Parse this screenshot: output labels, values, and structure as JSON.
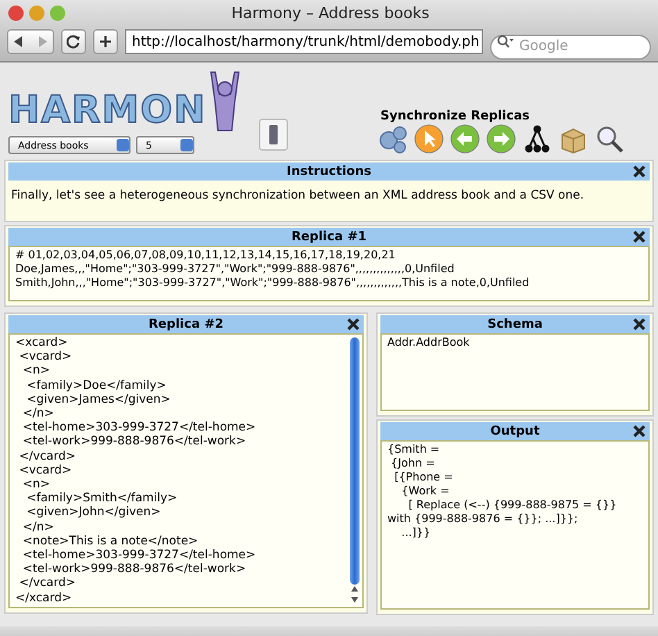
{
  "window": {
    "title": "Harmony – Address books"
  },
  "toolbar": {
    "url": "http://localhost/harmony/trunk/html/demobody.ph",
    "search_placeholder": "Google"
  },
  "header": {
    "logo": "HARMON",
    "selects": [
      {
        "value": "Address books"
      },
      {
        "value": "5"
      }
    ],
    "sync_title": "Synchronize Replicas"
  },
  "panels": [
    {
      "title": "Instructions",
      "kind": "note",
      "text": "Finally, let's see a heterogeneous synchronization between an XML address book and a CSV one."
    },
    {
      "title": "Replica #1",
      "kind": "editor",
      "text": "# 01,02,03,04,05,06,07,08,09,10,11,12,13,14,15,16,17,18,19,20,21\nDoe,James,,,\"Home\";\"303-999-3727\",\"Work\";\"999-888-9876\",,,,,,,,,,,,,,0,Unfiled\nSmith,John,,,\"Home\";\"303-999-3727\",\"Work\";\"999-888-9876\",,,,,,,,,,,,,This is a note,0,Unfiled"
    }
  ],
  "left_panels": [
    {
      "title": "Replica #2",
      "kind": "editor",
      "text": "<xcard>\n <vcard>\n  <n>\n   <family>Doe</family>\n   <given>James</given>\n  </n>\n  <tel-home>303-999-3727</tel-home>\n  <tel-work>999-888-9876</tel-work>\n </vcard>\n <vcard>\n  <n>\n   <family>Smith</family>\n   <given>John</given>\n  </n>\n  <note>This is a note</note>\n  <tel-home>303-999-3727</tel-home>\n  <tel-work>999-888-9876</tel-work>\n </vcard>\n</xcard>"
    }
  ],
  "right_panels": [
    {
      "title": "Schema",
      "kind": "editor",
      "text": "Addr.AddrBook"
    },
    {
      "title": "Output",
      "kind": "editor",
      "text": "{Smith =\n {John =\n  [{Phone =\n    {Work =\n      [ Replace (<--) {999-888-9875 = {}}\nwith {999-888-9876 = {}}; ...]}};\n    ...]}}"
    }
  ]
}
